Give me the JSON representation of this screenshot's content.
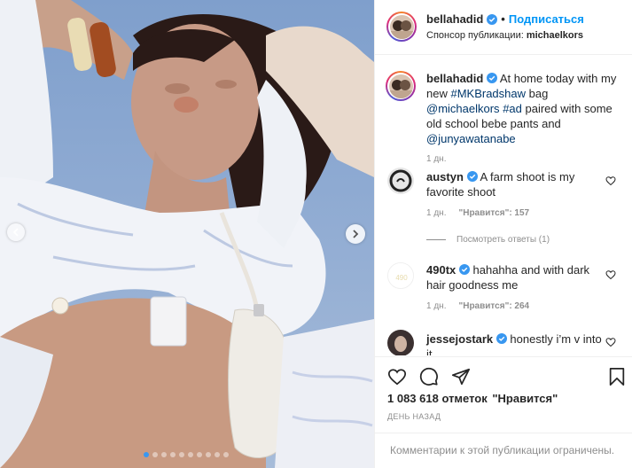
{
  "post": {
    "username": "bellahadid",
    "follow_label": "Подписаться",
    "dot": "•",
    "sponsor_label": "Спонсор публикации:",
    "sponsor_name": "michaelkors"
  },
  "caption": {
    "username": "bellahadid",
    "text_1": "At home today with my new ",
    "hashtag_1": "#MKBradshaw",
    "text_2": " bag ",
    "mention_1": "@michaelkors",
    "text_3": " ",
    "hashtag_2": "#ad",
    "text_4": " paired with some old school bebe pants and ",
    "mention_2": "@junyawatanabe",
    "time": "1 дн."
  },
  "comments": [
    {
      "username": "austyn",
      "text": "A farm shoot is my favorite shoot",
      "time": "1 дн.",
      "likes": "\"Нравится\": 157"
    },
    {
      "username": "490tx",
      "text": "hahahha and with dark hair goodness me",
      "time": "1 дн.",
      "likes": "\"Нравится\": 264"
    },
    {
      "username": "jessejostark",
      "text": "honestly i’m v into it",
      "time": "",
      "likes": ""
    }
  ],
  "view_replies": "Посмотреть ответы (1)",
  "likes_count": "1 083 618 отметок",
  "likes_word": "\"Нравится\"",
  "date_label": "ДЕНЬ НАЗАД",
  "comments_disabled": "Комментарии к этой публикации ограничены.",
  "carousel": {
    "slides": 10,
    "active_index": 0
  },
  "colors": {
    "accent": "#0095f6",
    "verified": "#3897f0",
    "link": "#00376b",
    "muted": "#8e8e8e"
  }
}
